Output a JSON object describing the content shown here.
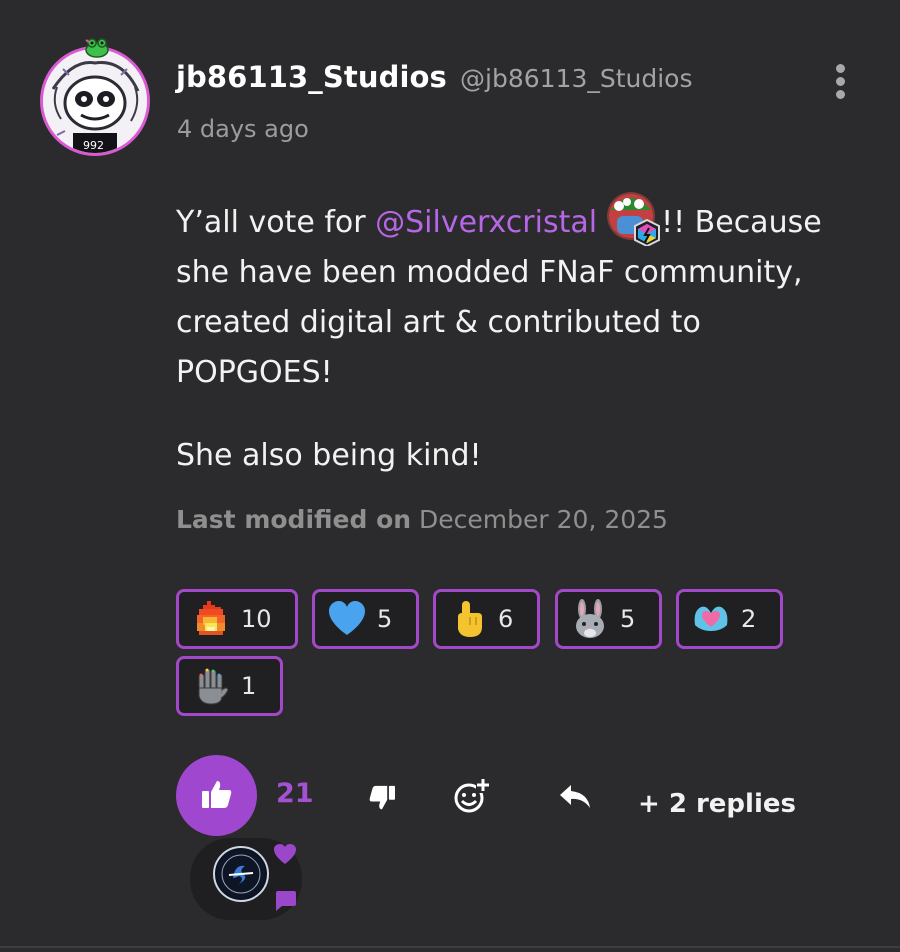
{
  "comment": {
    "username": "jb86113_Studios",
    "handle": "@jb86113_Studios",
    "timestamp": "4 days ago",
    "body": {
      "line1_prefix": "Y’all vote for ",
      "mention": "@Silverxcristal",
      "line1_suffix": "!! Because",
      "rest": "she have been modded FNaF community, created digital art & contributed to POPGOES!",
      "para2": "She also being kind!"
    },
    "modified_label": "Last modified on",
    "modified_date": "December 20, 2025"
  },
  "reactions": [
    {
      "icon": "fire-icon",
      "count": "10"
    },
    {
      "icon": "blue-heart-icon",
      "count": "5"
    },
    {
      "icon": "pointing-up-hand-icon",
      "count": "6"
    },
    {
      "icon": "rabbit-face-icon",
      "count": "5"
    },
    {
      "icon": "heart-hands-icon",
      "count": "2"
    },
    {
      "icon": "raised-hand-icon",
      "count": "1"
    }
  ],
  "actions": {
    "like_count": "21",
    "replies_label": "+ 2 replies"
  },
  "colors": {
    "background": "#2b2a2c",
    "accent": "#a249c9",
    "mention": "#b667e6",
    "muted": "#9c9c9c"
  }
}
